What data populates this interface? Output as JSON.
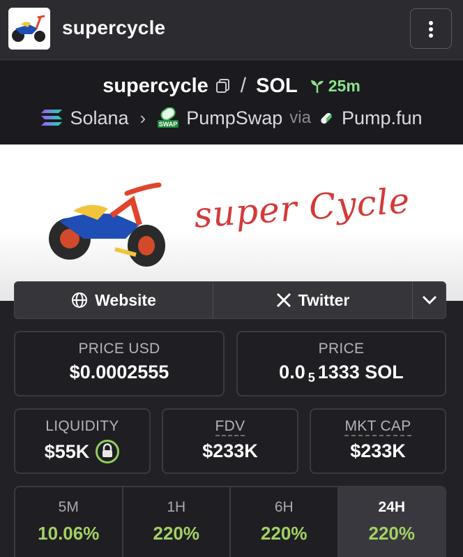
{
  "header": {
    "title": "supercycle"
  },
  "pair": {
    "base": "supercycle",
    "separator": "/",
    "quote": "SOL",
    "age": "25m"
  },
  "route": {
    "chain": "Solana",
    "dex": "PumpSwap",
    "via_label": "via",
    "launchpad": "Pump.fun"
  },
  "banner": {
    "text": "super Cycle"
  },
  "links": {
    "website": "Website",
    "twitter": "Twitter"
  },
  "stats": {
    "price_usd": {
      "label": "PRICE USD",
      "value": "$0.0002555"
    },
    "price_native": {
      "label": "PRICE",
      "lead": "0.0",
      "zeros": "5",
      "tail": "1333 SOL"
    },
    "liquidity": {
      "label": "LIQUIDITY",
      "value": "$55K"
    },
    "fdv": {
      "label": "FDV",
      "value": "$233K"
    },
    "mkt_cap": {
      "label": "MKT CAP",
      "value": "$233K"
    }
  },
  "timeframes": [
    {
      "label": "5M",
      "value": "10.06%"
    },
    {
      "label": "1H",
      "value": "220%"
    },
    {
      "label": "6H",
      "value": "220%"
    },
    {
      "label": "24H",
      "value": "220%",
      "active": true
    }
  ],
  "colors": {
    "positive": "#a3d162",
    "age": "#8be28a",
    "panel": "#1f1f23",
    "accent_green": "#8fd05a"
  }
}
